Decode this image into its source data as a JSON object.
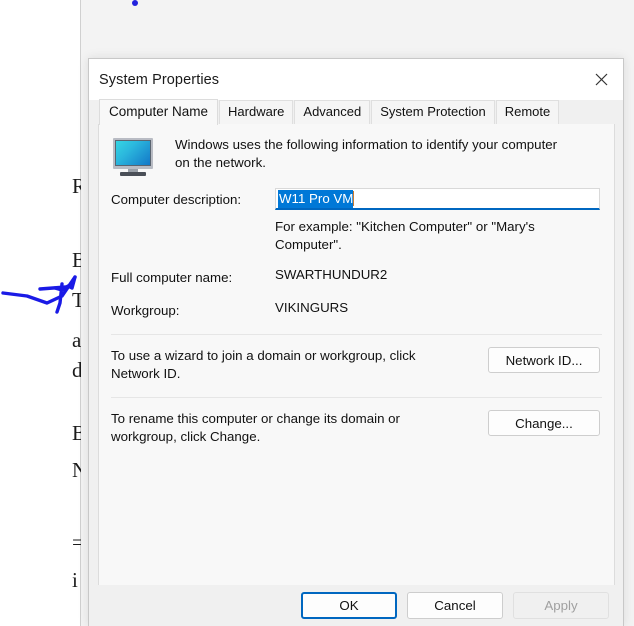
{
  "backdrop": {
    "clipped_letters": [
      "R",
      "B",
      "T",
      "a",
      "d",
      "B",
      "N",
      "=",
      "i"
    ]
  },
  "annotations": {
    "arrow_color": "#1a1ae6",
    "dot_color": "#2222dd"
  },
  "dialog": {
    "title": "System Properties",
    "close_icon": "close-icon",
    "tabs": [
      {
        "label": "Computer Name",
        "selected": true
      },
      {
        "label": "Hardware",
        "selected": false
      },
      {
        "label": "Advanced",
        "selected": false
      },
      {
        "label": "System Protection",
        "selected": false
      },
      {
        "label": "Remote",
        "selected": false
      }
    ],
    "intro": {
      "icon": "monitor-icon",
      "text": "Windows uses the following information to identify your computer on the network."
    },
    "computer_description": {
      "label": "Computer description:",
      "value": "W11 Pro VM",
      "placeholder": "",
      "hint": "For example: \"Kitchen Computer\" or \"Mary's Computer\"."
    },
    "full_computer_name": {
      "label": "Full computer name:",
      "value": "SWARTHUNDUR2"
    },
    "workgroup": {
      "label": "Workgroup:",
      "value": "VIKINGURS"
    },
    "network_id": {
      "text": "To use a wizard to join a domain or workgroup, click Network ID.",
      "button": "Network ID..."
    },
    "change": {
      "text": "To rename this computer or change its domain or workgroup, click Change.",
      "button": "Change..."
    },
    "footer": {
      "ok": "OK",
      "cancel": "Cancel",
      "apply": "Apply"
    }
  }
}
